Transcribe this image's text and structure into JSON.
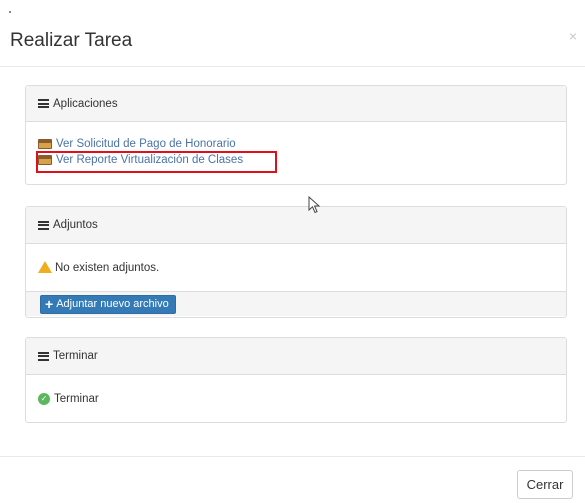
{
  "modal": {
    "title": "Realizar Tarea",
    "close_symbol": "×",
    "close_icon": "close-icon"
  },
  "panels": {
    "aplicaciones": {
      "heading": "Aplicaciones",
      "icon": "list-icon",
      "links": [
        {
          "label": "Ver Solicitud de Pago de Honorario",
          "icon": "folder-icon"
        },
        {
          "label": "Ver Reporte Virtualización de Clases",
          "icon": "folder-icon",
          "highlighted": true
        }
      ]
    },
    "adjuntos": {
      "heading": "Adjuntos",
      "icon": "list-icon",
      "message": "No existen adjuntos.",
      "message_icon": "warning-icon",
      "button_label": "Adjuntar nuevo archivo",
      "button_icon": "plus-icon"
    },
    "terminar": {
      "heading": "Terminar",
      "icon": "list-icon",
      "action_label": "Terminar",
      "action_icon": "check-circle-icon"
    }
  },
  "footer": {
    "close_button_label": "Cerrar"
  },
  "colors": {
    "link": "#4a74a8",
    "primary": "#337ab7",
    "highlight_border": "#e0101a",
    "warning": "#f0ad1e",
    "success": "#5cb85c"
  }
}
